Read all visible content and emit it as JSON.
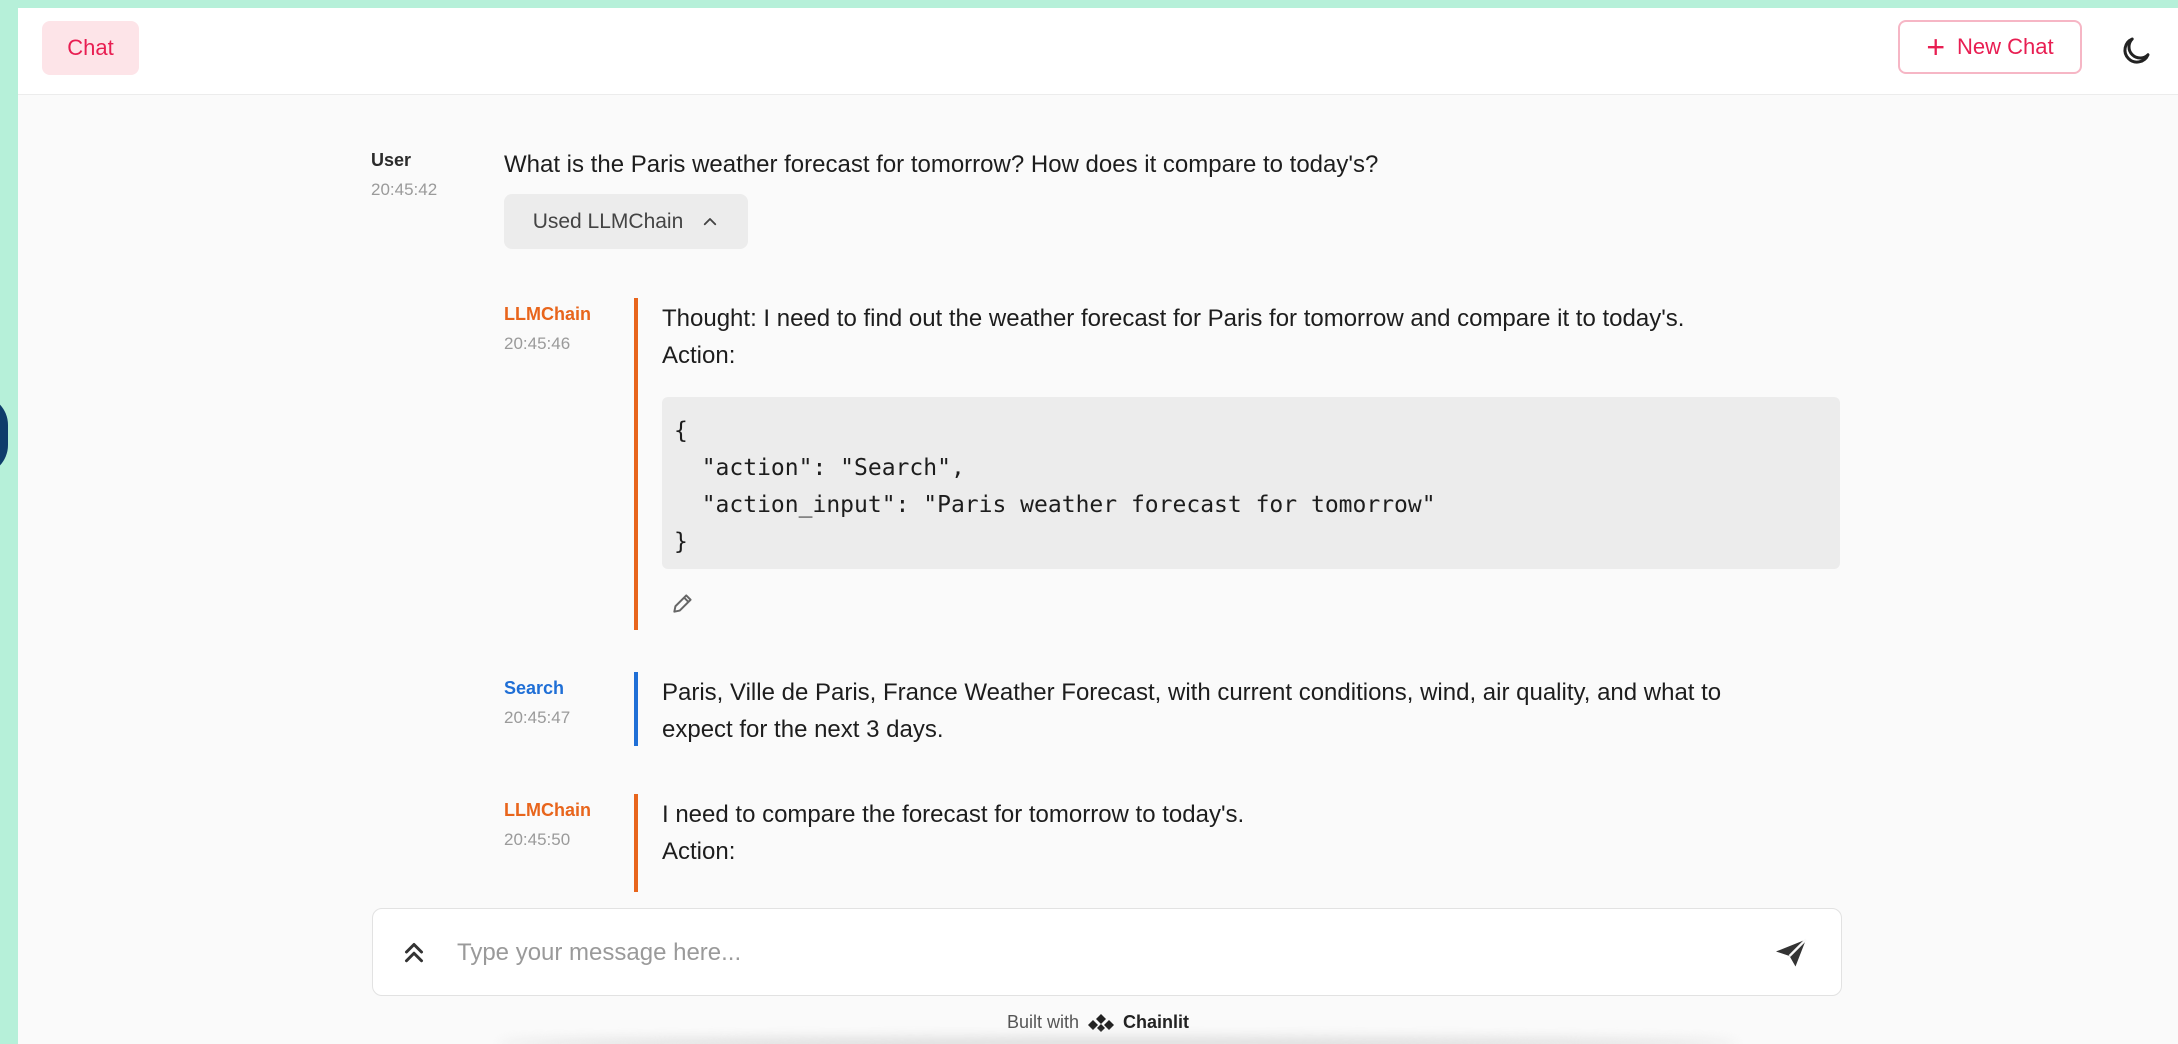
{
  "header": {
    "tab_label": "Chat",
    "new_chat_label": "New Chat",
    "theme_toggle_icon": "moon-icon",
    "accent_color": "#e81e52"
  },
  "messages": [
    {
      "author": "User",
      "time": "20:45:42",
      "text": "What is the Paris weather forecast for tomorrow? How does it compare to today's?",
      "chip_label": "Used LLMChain"
    },
    {
      "author": "LLMChain",
      "time": "20:45:46",
      "line1": "Thought: I need to find out the weather forecast for Paris for tomorrow and compare it to today's.",
      "line2": "Action:",
      "code": "{\n  \"action\": \"Search\",\n  \"action_input\": \"Paris weather forecast for tomorrow\"\n}",
      "color": "#e8651c"
    },
    {
      "author": "Search",
      "time": "20:45:47",
      "line1": "Paris, Ville de Paris, France Weather Forecast, with current conditions, wind, air quality, and what to",
      "line2": "expect for the next 3 days.",
      "color": "#1f6fd6"
    },
    {
      "author": "LLMChain",
      "time": "20:45:50",
      "line1": "I need to compare the forecast for tomorrow to today's.",
      "line2": "Action:",
      "color": "#e8651c"
    }
  ],
  "composer": {
    "placeholder": "Type your message here...",
    "value": ""
  },
  "footer": {
    "built_with": "Built with",
    "brand": "Chainlit"
  }
}
